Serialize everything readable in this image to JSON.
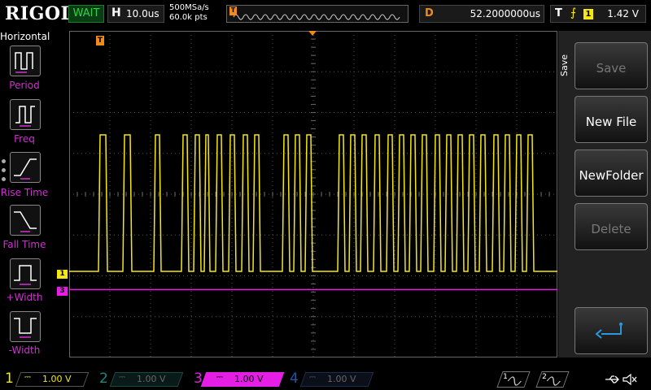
{
  "brand": "RIGOL",
  "status": "WAIT",
  "horizontal": {
    "letter": "H",
    "timebase": "10.0us",
    "sample_rate": "500MSa/s",
    "memory_depth": "60.0k pts"
  },
  "trigger_position_marker": "T",
  "delay": {
    "letter": "D",
    "value": "52.2000000us"
  },
  "trigger": {
    "letter": "T",
    "edge": "⨍",
    "source": "1",
    "level": "1.42 V"
  },
  "left_menu": {
    "title": "Horizontal",
    "items": [
      {
        "label": "Period",
        "icon": "period-icon"
      },
      {
        "label": "Freq",
        "icon": "freq-icon"
      },
      {
        "label": "Rise Time",
        "icon": "rise-time-icon"
      },
      {
        "label": "Fall Time",
        "icon": "fall-time-icon"
      },
      {
        "label": "+Width",
        "icon": "pos-width-icon"
      },
      {
        "label": "-Width",
        "icon": "neg-width-icon"
      }
    ]
  },
  "right_menu": {
    "tab_label": "Save",
    "items": [
      {
        "label": "Save",
        "enabled": false
      },
      {
        "label": "New File",
        "enabled": true
      },
      {
        "label": "NewFolder",
        "enabled": true
      },
      {
        "label": "Delete",
        "enabled": false
      },
      {
        "label": "",
        "icon": "return-icon",
        "enabled": true
      }
    ]
  },
  "channels": [
    {
      "num": "1",
      "coupling": "DC",
      "scale": "1.00 V",
      "color": "#f5e716",
      "active": true
    },
    {
      "num": "2",
      "coupling": "DC",
      "scale": "1.00 V",
      "color": "#1a8a80",
      "active": false
    },
    {
      "num": "3",
      "coupling": "DC",
      "scale": "1.00 V",
      "color": "#e51ee5",
      "active": true
    },
    {
      "num": "4",
      "coupling": "DC",
      "scale": "1.00 V",
      "color": "#2255aa",
      "active": false
    }
  ],
  "markers": {
    "ch1": "1",
    "ch3": "3",
    "trigger_level": "T"
  },
  "generators": [
    {
      "label": "1"
    },
    {
      "label": "2"
    }
  ],
  "colors": {
    "ch1": "#f5e716",
    "ch3": "#e51ee5",
    "trigger": "#f28a1a",
    "grid": "#555555",
    "menu_accent": "#d030d0"
  }
}
